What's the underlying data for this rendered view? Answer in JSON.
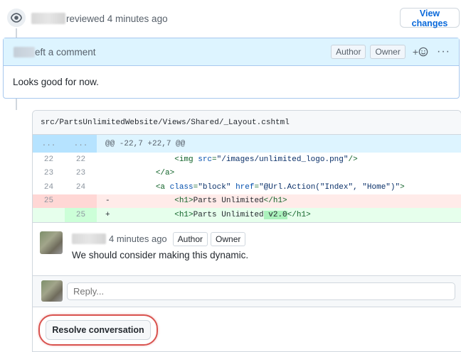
{
  "review": {
    "action_text": "reviewed 4 minutes ago",
    "view_changes_label": "View changes"
  },
  "comment": {
    "action_text": "eft a comment",
    "labels": [
      "Author",
      "Owner"
    ],
    "reaction_label": "+",
    "more_label": "···",
    "body": "Looks good for now."
  },
  "thread": {
    "file_path": "src/PartsUnlimitedWebsite/Views/Shared/_Layout.cshtml",
    "hunk": {
      "left": "...",
      "right": "...",
      "header": "@@ -22,7 +22,7 @@"
    },
    "diff_lines": [
      {
        "type": "ctx",
        "left": "22",
        "right": "22",
        "sign": " ",
        "indent": "            ",
        "parts": [
          [
            "tag",
            "<img "
          ],
          [
            "attr",
            "src"
          ],
          [
            "tag",
            "="
          ],
          [
            "str",
            "\"/images/unlimited_logo.png\""
          ],
          [
            "tag",
            "/>"
          ]
        ]
      },
      {
        "type": "ctx",
        "left": "23",
        "right": "23",
        "sign": " ",
        "indent": "        ",
        "parts": [
          [
            "tag",
            "</a>"
          ]
        ]
      },
      {
        "type": "ctx",
        "left": "24",
        "right": "24",
        "sign": " ",
        "indent": "        ",
        "parts": [
          [
            "tag",
            "<a "
          ],
          [
            "attr",
            "class"
          ],
          [
            "tag",
            "="
          ],
          [
            "str",
            "\"block\" "
          ],
          [
            "attr",
            "href"
          ],
          [
            "tag",
            "="
          ],
          [
            "str",
            "\"@Url.Action(\"Index\", \"Home\")\""
          ],
          [
            "tag",
            ">"
          ]
        ]
      },
      {
        "type": "del",
        "left": "25",
        "right": "",
        "sign": "-",
        "indent": "            ",
        "parts": [
          [
            "tag",
            "<h1>"
          ],
          [
            "plain",
            "Parts Unlimited"
          ],
          [
            "tag",
            "</h1>"
          ]
        ]
      },
      {
        "type": "add",
        "left": "",
        "right": "25",
        "sign": "+",
        "indent": "            ",
        "parts": [
          [
            "tag",
            "<h1>"
          ],
          [
            "plain",
            "Parts Unlimited"
          ],
          [
            "mark",
            " v2.0"
          ],
          [
            "tag",
            "</h1>"
          ]
        ]
      }
    ],
    "reply_comment": {
      "time": "4 minutes ago",
      "labels": [
        "Author",
        "Owner"
      ],
      "text": "We should consider making this dynamic."
    },
    "reply_placeholder": "Reply...",
    "resolve_label": "Resolve conversation"
  }
}
